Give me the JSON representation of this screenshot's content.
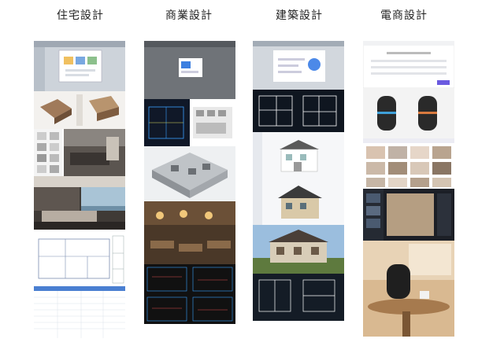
{
  "columns": [
    {
      "title": "住宅設計",
      "tiles": [
        {
          "kind": "software-dialog-screenshot"
        },
        {
          "kind": "isometric-floorplan-renders"
        },
        {
          "kind": "furniture-library-interior-render"
        },
        {
          "kind": "living-room-render"
        },
        {
          "kind": "cad-drawing"
        },
        {
          "kind": "quotation-spreadsheet"
        }
      ]
    },
    {
      "title": "商業設計",
      "tiles": [
        {
          "kind": "software-dialog-dark"
        },
        {
          "kind": "commercial-floorplan-cad"
        },
        {
          "kind": "office-3d-model"
        },
        {
          "kind": "restaurant-interior-render"
        },
        {
          "kind": "dark-cad-sheets"
        }
      ]
    },
    {
      "title": "建築設計",
      "tiles": [
        {
          "kind": "software-dialog-blue"
        },
        {
          "kind": "building-floorplans-dark"
        },
        {
          "kind": "villa-3d-model-white"
        },
        {
          "kind": "villa-3d-model-roof"
        },
        {
          "kind": "villa-photorealistic-render"
        },
        {
          "kind": "dark-elevation-plans"
        }
      ]
    },
    {
      "title": "電商設計",
      "tiles": [
        {
          "kind": "web-form-screenshot"
        },
        {
          "kind": "smart-speaker-product-shots"
        },
        {
          "kind": "ecommerce-catalog-grid"
        },
        {
          "kind": "dark-editor-interface"
        },
        {
          "kind": "speaker-lifestyle-photo"
        }
      ]
    }
  ]
}
